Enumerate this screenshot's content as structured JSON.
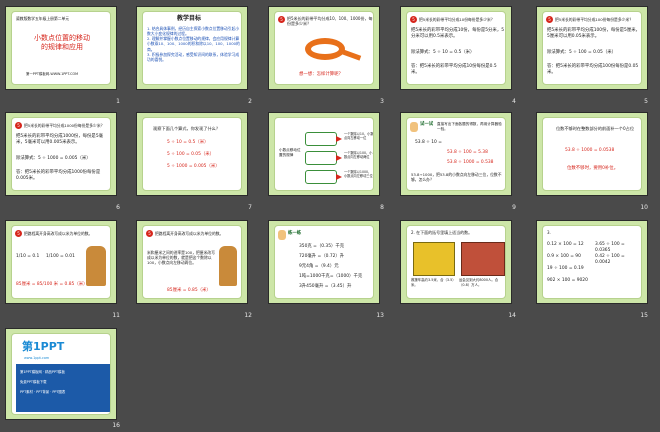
{
  "slides": [
    {
      "num": "1",
      "subtitle": "冀教版数学五年级上册第二单元",
      "title": "小数点位置的移动\n的规律和应用",
      "footer": "第一PPT模板网-WWW.1PPT.COM"
    },
    {
      "num": "2",
      "heading": "教学目标",
      "body": "1. 结合具体事例，经历自主探索小数点位置移动引起小数大小变化规律的过程。\n2. 理解并掌握小数点位置移动的规律，会应用规律计算小数乘10、100、1000的积和除以10、100、1000的商。\n3. 积极参加探究活动，感受知识间的联系，体验学习成功的喜悦。"
    },
    {
      "num": "3",
      "question": "把5米长的彩带平均分成10、100、1000份，每份是多少米？",
      "caption": "想一想：怎样计算呢？"
    },
    {
      "num": "4",
      "question": "把5米长的彩带平均分成10份每份是多少米？",
      "line1": "把5米长的彩带平均分成10份，每份是5分米，5分米可以用0.5米表示。",
      "formula": "除法算式：5 ÷ 10 = 0.5（米）",
      "answer": "答：把5米长的彩带平均分成10份每份是0.5米。"
    },
    {
      "num": "5",
      "question": "把5米长的彩带平均分成100份每份是多少米？",
      "line1": "把5米长的彩带平均分成100份，每份是5厘米，5厘米可以用0.05米表示。",
      "formula": "除法算式：5 ÷ 100 = 0.05（米）",
      "answer": "答：把5米长的彩带平均分成100份每份是0.05米。"
    },
    {
      "num": "6",
      "question": "把5米长的彩带平均分成1000份每份是多少米？",
      "line1": "把5米长的彩带平均分成1000份，每份是5毫米，5毫米可以用0.005米表示。",
      "formula": "除法算式：5 ÷ 1000 = 0.005（米）",
      "answer": "答：把5米长的彩带平均分成1000份每份是0.005米。"
    },
    {
      "num": "7",
      "question": "观察下面几个算式，你发现了什么？",
      "eqs": [
        "5 ÷ 10 = 0.5（米）",
        "5 ÷ 100 = 0.05（米）",
        "5 ÷ 1000 = 0.005（米）"
      ]
    },
    {
      "num": "8",
      "left": "小数点移动位置的规律",
      "boxes": [
        "一个数除以10，小数点向左移动一位",
        "一个数除以100，小数点向左移动两位",
        "一个数除以1000，小数点向左移动三位"
      ]
    },
    {
      "num": "9",
      "badge": "试一试",
      "intro": "直接写出下面各题的得数，再用计算器验一验。",
      "eqs": [
        "53.8 ÷ 10 =",
        "53.8 ÷ 100 = 5.38",
        "53.8 ÷ 1000 = 0.538",
        "53.8 ÷ 10 = 5.38"
      ],
      "summary": "53.8÷1000，把53.8的小数点向左移动三位，位数不够，怎么办？"
    },
    {
      "num": "10",
      "text": "位数不够时在整数部分的前面补一个0占位",
      "eq": "53.8 ÷ 1000 = 0.0538",
      "note": "位数不够时，要用0补位。"
    },
    {
      "num": "11",
      "heading": "把路程离开身高改写成以米为单位的数。",
      "eq1": "1/10 = 0.1",
      "eq2": "1/100 = 0.01",
      "eq3": "85厘米 = 85/100 米 = 0.85（米）"
    },
    {
      "num": "12",
      "heading": "把路程离开身高改写成以米为单位的数。",
      "body": "米和厘米之间的进率是100，把厘米改写成以米为单位的数，就是把这个数除以100，小数点向左移动两位。",
      "eq": "85厘米 = 0.85（米）"
    },
    {
      "num": "13",
      "badge": "练一练",
      "items": [
        "350克 =（0.35）千克",
        "720毫升 =（0.72）升",
        "9元4角 =（9.4）元",
        "1吨=1000千克=（1000）千克",
        "3升450毫升 =（3.45）升"
      ]
    },
    {
      "num": "14",
      "heading": "2. 在下面的括号里填上适当的数。",
      "cap1": "救援车高约3.5米，合（3.5）米。",
      "cap2": "运会见到大约8000人。合（0.8）万人。"
    },
    {
      "num": "15",
      "heading": "3.",
      "left": [
        "0.12 × 100 = 12",
        "0.9 × 100 = 90",
        "19 ÷ 100 = 0.19",
        "902 × 100 = 9020"
      ],
      "right": [
        "3.65 ÷ 100 = 0.0365",
        "0.42 ÷ 100 = 0.0042",
        "",
        "9020"
      ]
    },
    {
      "num": "16",
      "logo": "第1PPT",
      "sub": "www.1ppt.com",
      "lines": [
        "第1PPT模板网 · 精品PPT模板",
        "免费PPT模板下载",
        "PPT素材 · PPT背景 · PPT图表"
      ]
    }
  ]
}
